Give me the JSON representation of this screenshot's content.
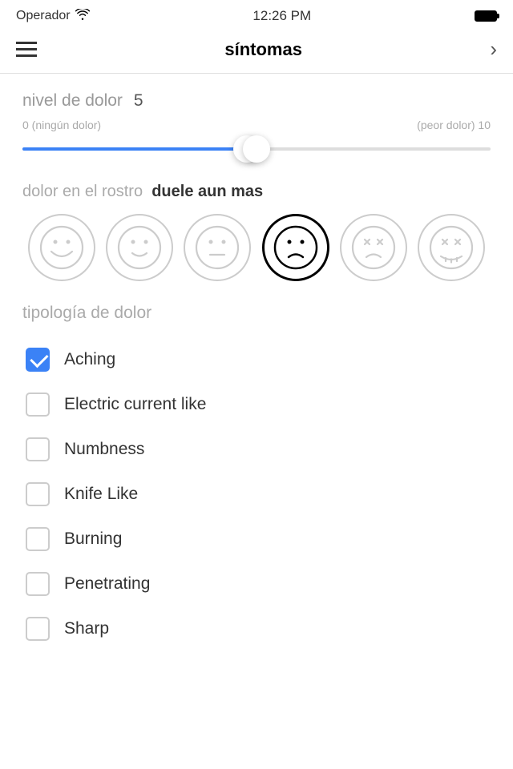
{
  "statusBar": {
    "carrier": "Operador",
    "time": "12:26 PM"
  },
  "header": {
    "title": "síntomas",
    "nextLabel": "›"
  },
  "painLevel": {
    "label": "nivel de dolor",
    "value": 5,
    "min": 0,
    "max": 10,
    "minLabel": "0 (ningún dolor)",
    "maxLabel": "(peor dolor) 10"
  },
  "faceSection": {
    "labelGray": "dolor en el rostro",
    "labelBold": "duele aun mas",
    "faces": [
      {
        "id": 0,
        "title": "happy-big",
        "selected": false
      },
      {
        "id": 1,
        "title": "happy-small",
        "selected": false
      },
      {
        "id": 2,
        "title": "neutral",
        "selected": false
      },
      {
        "id": 3,
        "title": "sad",
        "selected": true
      },
      {
        "id": 4,
        "title": "very-sad",
        "selected": false
      },
      {
        "id": 5,
        "title": "worst",
        "selected": false
      }
    ]
  },
  "tipologia": {
    "label": "tipología de dolor",
    "items": [
      {
        "id": 0,
        "label": "Aching",
        "checked": true
      },
      {
        "id": 1,
        "label": "Electric current like",
        "checked": false
      },
      {
        "id": 2,
        "label": "Numbness",
        "checked": false
      },
      {
        "id": 3,
        "label": "Knife Like",
        "checked": false
      },
      {
        "id": 4,
        "label": "Burning",
        "checked": false
      },
      {
        "id": 5,
        "label": "Penetrating",
        "checked": false
      },
      {
        "id": 6,
        "label": "Sharp",
        "checked": false
      }
    ]
  }
}
